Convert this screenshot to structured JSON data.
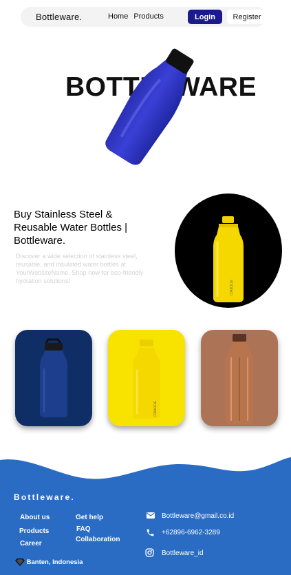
{
  "nav": {
    "brand": "Bottleware.",
    "links": [
      "Home",
      "Products"
    ],
    "login_label": "Login",
    "register_label": "Register"
  },
  "hero": {
    "title": "BOTTLEWARE"
  },
  "intro": {
    "title": "Buy Stainless Steel & Reusable Water Bottles | Bottleware.",
    "description": "Discover a wide selection of stainless steel, reusable, and insulated water bottles at YourWebsiteName. Shop now for eco-friendly hydration solutions!"
  },
  "products": [
    {
      "color": "#102e66",
      "bottle_color": "#1d3e8c"
    },
    {
      "color": "#f8e300",
      "bottle_color": "#f4d800"
    },
    {
      "color": "#ad7357",
      "bottle_color": "#b8754d"
    }
  ],
  "footer": {
    "brand": "Bottleware.",
    "col1": [
      "About us",
      "Products",
      "Career"
    ],
    "col2": [
      "Get help",
      "FAQ",
      "Collaboration"
    ],
    "email": "Bottleware@gmail.co.id",
    "phone": "+62896-6962-3289",
    "instagram": "Bottleware_id",
    "location": "Banten, Indonesia",
    "bg_color": "#2a6cc4"
  },
  "colors": {
    "accent": "#1a1a8c",
    "hero_bottle": "#2f35c9"
  }
}
